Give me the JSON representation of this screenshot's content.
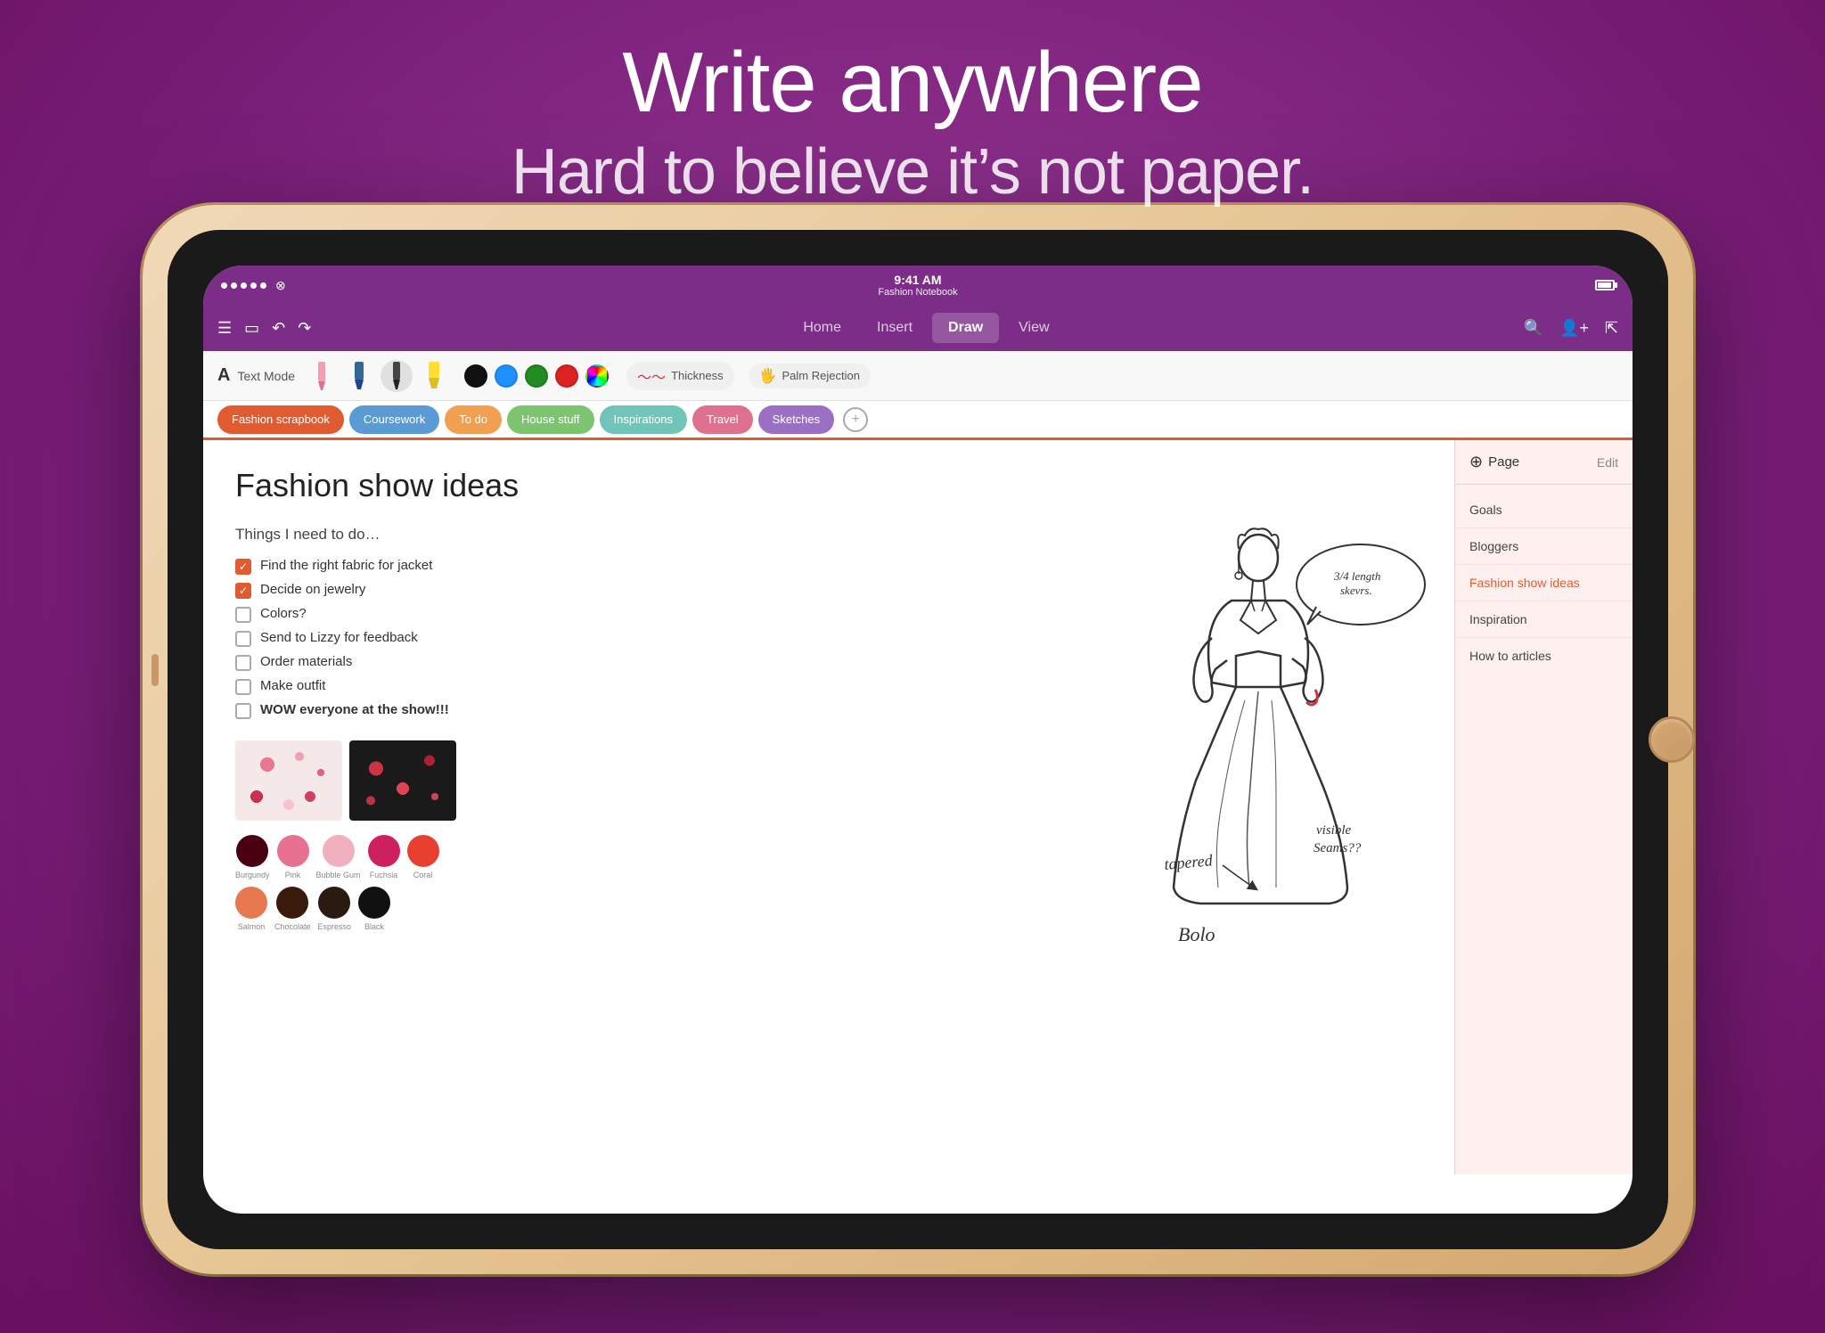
{
  "background_color": "#8B2D8B",
  "headline": {
    "main": "Write anywhere",
    "sub": "Hard to believe it’s not paper."
  },
  "status_bar": {
    "time": "9:41 AM",
    "notebook_name": "Fashion Notebook"
  },
  "nav": {
    "tabs": [
      "Home",
      "Insert",
      "Draw",
      "View"
    ],
    "active_tab": "Draw"
  },
  "toolbar": {
    "text_mode_label": "Text Mode",
    "thickness_label": "Thickness",
    "palm_rejection_label": "Palm Rejection"
  },
  "notebook_tabs": [
    {
      "label": "Fashion scrapbook",
      "color": "active"
    },
    {
      "label": "Coursework",
      "color": "blue"
    },
    {
      "label": "To do",
      "color": "orange"
    },
    {
      "label": "House stuff",
      "color": "green"
    },
    {
      "label": "Inspirations",
      "color": "teal"
    },
    {
      "label": "Travel",
      "color": "pink"
    },
    {
      "label": "Sketches",
      "color": "purple"
    }
  ],
  "page": {
    "title": "Fashion show ideas",
    "things_header": "Things I need to do…",
    "todos": [
      {
        "text": "Find the right fabric for jacket",
        "checked": true
      },
      {
        "text": "Decide on jewelry",
        "checked": true
      },
      {
        "text": "Colors?",
        "checked": false
      },
      {
        "text": "Send to Lizzy for feedback",
        "checked": false
      },
      {
        "text": "Order materials",
        "checked": false
      },
      {
        "text": "Make outfit",
        "checked": false
      },
      {
        "text": "WOW everyone at the show!!!",
        "checked": false,
        "bold": true
      }
    ]
  },
  "color_swatches": [
    {
      "color": "#4A0010",
      "label": "Burgundy"
    },
    {
      "color": "#E87090",
      "label": "Pink"
    },
    {
      "color": "#F0B0C0",
      "label": "Bubble Gum"
    },
    {
      "color": "#CC2060",
      "label": "Fuchsia"
    },
    {
      "color": "#E84030",
      "label": "Coral"
    }
  ],
  "color_swatches2": [
    {
      "color": "#E87850",
      "label": "Salmon"
    },
    {
      "color": "#3A1A0A",
      "label": "Chocolate"
    },
    {
      "color": "#2A1A10",
      "label": "Espresso"
    },
    {
      "color": "#111111",
      "label": "Black"
    }
  ],
  "right_panel": {
    "add_label": "Page",
    "edit_label": "Edit",
    "items": [
      {
        "label": "Goals",
        "active": false
      },
      {
        "label": "Bloggers",
        "active": false
      },
      {
        "label": "Fashion show ideas",
        "active": true
      },
      {
        "label": "Inspiration",
        "active": false
      },
      {
        "label": "How to articles",
        "active": false
      }
    ]
  },
  "pen_colors": [
    {
      "color": "#000000",
      "label": "black"
    },
    {
      "color": "#1E90FF",
      "label": "blue"
    },
    {
      "color": "#228B22",
      "label": "green"
    },
    {
      "color": "#DD2222",
      "label": "red"
    },
    {
      "color": "rainbow",
      "label": "color-picker"
    }
  ]
}
